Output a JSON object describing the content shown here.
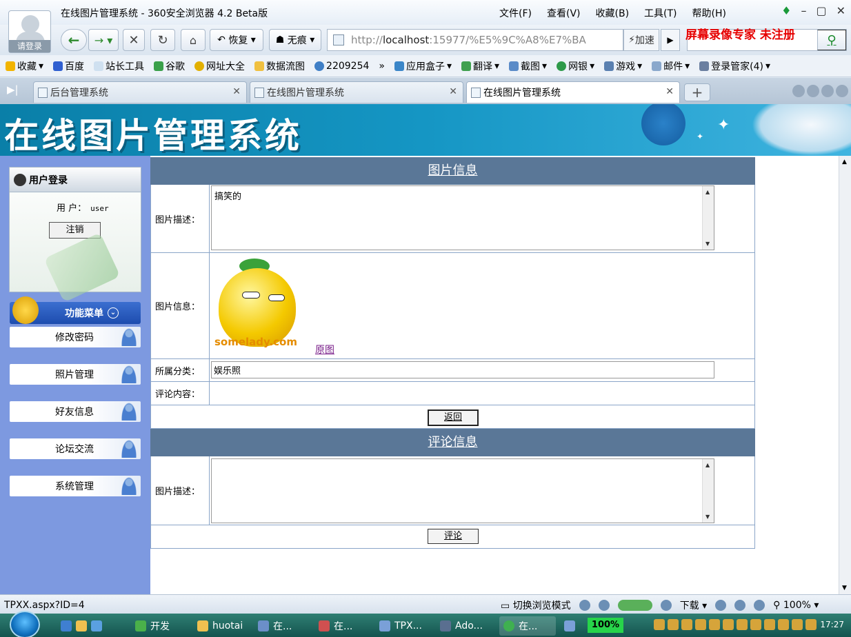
{
  "browser": {
    "window_title": "在线图片管理系统 - 360安全浏览器 4.2 Beta版",
    "avatar_label": "请登录",
    "menu": [
      "文件(F)",
      "查看(V)",
      "收藏(B)",
      "工具(T)",
      "帮助(H)"
    ],
    "nav": {
      "restore_label": "恢复",
      "incognito_label": "无痕",
      "address_scheme": "http://",
      "address_host": "localhost",
      "address_rest": ":15977/%E5%9C%A8%E7%BA",
      "speed_label": "加速"
    },
    "watermark": "屏幕录像专家 未注册",
    "favorites": [
      "收藏",
      "百度",
      "站长工具",
      "谷歌",
      "网址大全",
      "数据流图",
      "2209254",
      "应用盒子",
      "翻译",
      "截图",
      "网银",
      "游戏",
      "邮件",
      "登录管家(4)"
    ],
    "tabs": [
      {
        "label": "后台管理系统"
      },
      {
        "label": "在线图片管理系统"
      },
      {
        "label": "在线图片管理系统"
      }
    ]
  },
  "page": {
    "banner_title": "在线图片管理系统",
    "login": {
      "header": "用户登录",
      "user_label": "用 户：",
      "user_value": "user",
      "logout_label": "注销"
    },
    "menu_header": "功能菜单",
    "menu_items": [
      "修改密码",
      "照片管理",
      "好友信息",
      "论坛交流",
      "系统管理"
    ],
    "photo_section_title": "图片信息",
    "desc_label": "图片描述：",
    "desc_value": "搞笑的",
    "image_label": "图片信息：",
    "image_caption": "somelady.com",
    "original_link": "原图",
    "category_label": "所属分类：",
    "category_value": "娱乐照",
    "comment_content_label": "评论内容：",
    "back_button": "返回",
    "comment_section_title": "评论信息",
    "comment_desc_label": "图片描述：",
    "comment_button": "评论"
  },
  "statusbar": {
    "url": "TPXX.aspx?ID=4",
    "mode": "切换浏览模式",
    "download": "下载",
    "zoom": "100%"
  },
  "taskbar": {
    "items": [
      "开发",
      "huotai",
      "在...",
      "在...",
      "TPX...",
      "Ado...",
      "在..."
    ],
    "percent": "100%",
    "clock": "17:27"
  }
}
